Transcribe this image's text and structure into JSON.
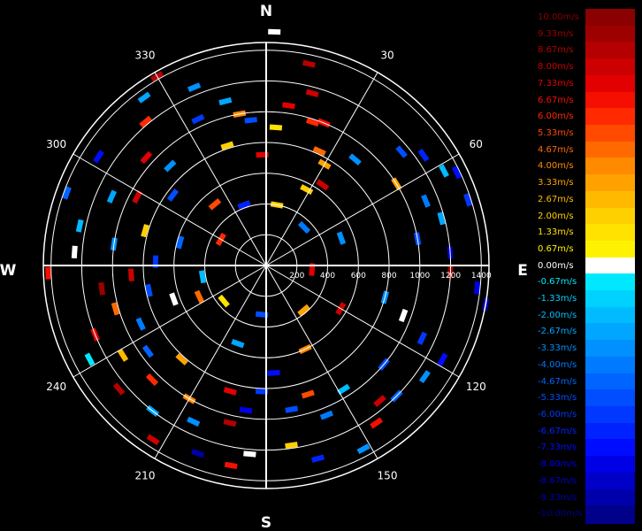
{
  "chart_data": {
    "type": "polar-radar",
    "compass": {
      "north": "N",
      "east": "E",
      "south": "S",
      "west": "W"
    },
    "azimuth_labels": [
      "30",
      "60",
      "120",
      "150",
      "210",
      "240",
      "300",
      "330"
    ],
    "azimuths_deg": [
      30,
      60,
      120,
      150,
      210,
      240,
      300,
      330
    ],
    "range_labels": [
      "200",
      "400",
      "600",
      "800",
      "1000",
      "1200",
      "1400"
    ],
    "range_values": [
      200,
      400,
      600,
      800,
      1000,
      1200,
      1400
    ],
    "range_max": 1450,
    "grid": true,
    "legend_placement": "right",
    "legend": [
      {
        "label": "10.00m/s",
        "color": "#8b0000"
      },
      {
        "label": "9.33m/s",
        "color": "#9e0000"
      },
      {
        "label": "8.67m/s",
        "color": "#b40000"
      },
      {
        "label": "8.00m/s",
        "color": "#cc0000"
      },
      {
        "label": "7.33m/s",
        "color": "#e30000"
      },
      {
        "label": "6.67m/s",
        "color": "#f50f00"
      },
      {
        "label": "6.00m/s",
        "color": "#ff2a00"
      },
      {
        "label": "5.33m/s",
        "color": "#ff4a00"
      },
      {
        "label": "4.67m/s",
        "color": "#ff6a00"
      },
      {
        "label": "4.00m/s",
        "color": "#ff8a00"
      },
      {
        "label": "3.33m/s",
        "color": "#ffa200"
      },
      {
        "label": "2.67m/s",
        "color": "#ffba00"
      },
      {
        "label": "2.00m/s",
        "color": "#ffd000"
      },
      {
        "label": "1.33m/s",
        "color": "#ffe200"
      },
      {
        "label": "0.67m/s",
        "color": "#fff200"
      },
      {
        "label": "0.00m/s",
        "color": "#ffffff"
      },
      {
        "label": "-0.67m/s",
        "color": "#00e8ff"
      },
      {
        "label": "-1.33m/s",
        "color": "#00d2ff"
      },
      {
        "label": "-2.00m/s",
        "color": "#00bcff"
      },
      {
        "label": "-2.67m/s",
        "color": "#00a6ff"
      },
      {
        "label": "-3.33m/s",
        "color": "#0090ff"
      },
      {
        "label": "-4.00m/s",
        "color": "#007aff"
      },
      {
        "label": "-4.67m/s",
        "color": "#0064ff"
      },
      {
        "label": "-5.33m/s",
        "color": "#004eff"
      },
      {
        "label": "-6.00m/s",
        "color": "#0038ff"
      },
      {
        "label": "-6.67m/s",
        "color": "#0022ff"
      },
      {
        "label": "-7.33m/s",
        "color": "#000cff"
      },
      {
        "label": "-8.00m/s",
        "color": "#0000e6"
      },
      {
        "label": "-8.67m/s",
        "color": "#0000c8"
      },
      {
        "label": "-9.33m/s",
        "color": "#0000aa"
      },
      {
        "label": "-10.00m/s",
        "color": "#00008b"
      }
    ],
    "gates": [
      {
        "az": 2,
        "r": 1520,
        "v": 0.0
      },
      {
        "az": 12,
        "r": 1340,
        "v": 8.7
      },
      {
        "az": 15,
        "r": 1160,
        "v": 8.0
      },
      {
        "az": 8,
        "r": 1050,
        "v": 7.3
      },
      {
        "az": 18,
        "r": 980,
        "v": 6.0
      },
      {
        "az": 4,
        "r": 900,
        "v": 1.3
      },
      {
        "az": 25,
        "r": 820,
        "v": 4.7
      },
      {
        "az": 22,
        "r": 1000,
        "v": 6.7
      },
      {
        "az": 30,
        "r": 760,
        "v": 3.3
      },
      {
        "az": 28,
        "r": 560,
        "v": 2.0
      },
      {
        "az": 35,
        "r": 640,
        "v": 8.0
      },
      {
        "az": 40,
        "r": 900,
        "v": -3.3
      },
      {
        "az": 50,
        "r": 1150,
        "v": -5.3
      },
      {
        "az": 55,
        "r": 1250,
        "v": -6.7
      },
      {
        "az": 62,
        "r": 1310,
        "v": -2.0
      },
      {
        "az": 64,
        "r": 1380,
        "v": -7.3
      },
      {
        "az": 58,
        "r": 1000,
        "v": 3.3
      },
      {
        "az": 68,
        "r": 1120,
        "v": -4.0
      },
      {
        "az": 72,
        "r": 1380,
        "v": -6.0
      },
      {
        "az": 75,
        "r": 1180,
        "v": -2.7
      },
      {
        "az": 80,
        "r": 1000,
        "v": -5.3
      },
      {
        "az": 86,
        "r": 1200,
        "v": -8.7
      },
      {
        "az": 92,
        "r": 1200,
        "v": 9.3
      },
      {
        "az": 96,
        "r": 1380,
        "v": -8.0
      },
      {
        "az": 100,
        "r": 1450,
        "v": -9.3
      },
      {
        "az": 105,
        "r": 800,
        "v": -3.3
      },
      {
        "az": 110,
        "r": 950,
        "v": 0.0
      },
      {
        "az": 115,
        "r": 1120,
        "v": -6.0
      },
      {
        "az": 118,
        "r": 1300,
        "v": -7.3
      },
      {
        "az": 125,
        "r": 1260,
        "v": -3.3
      },
      {
        "az": 130,
        "r": 1000,
        "v": -5.3
      },
      {
        "az": 135,
        "r": 1200,
        "v": -4.7
      },
      {
        "az": 140,
        "r": 1150,
        "v": 8.0
      },
      {
        "az": 145,
        "r": 1250,
        "v": 6.7
      },
      {
        "az": 148,
        "r": 950,
        "v": -2.0
      },
      {
        "az": 152,
        "r": 1350,
        "v": -3.3
      },
      {
        "az": 155,
        "r": 600,
        "v": 4.0
      },
      {
        "az": 158,
        "r": 1050,
        "v": -4.0
      },
      {
        "az": 162,
        "r": 880,
        "v": 5.3
      },
      {
        "az": 165,
        "r": 1300,
        "v": -6.7
      },
      {
        "az": 170,
        "r": 950,
        "v": -5.3
      },
      {
        "az": 172,
        "r": 1180,
        "v": 2.0
      },
      {
        "az": 176,
        "r": 700,
        "v": -7.3
      },
      {
        "az": 182,
        "r": 820,
        "v": -6.0
      },
      {
        "az": 185,
        "r": 1230,
        "v": 0.0
      },
      {
        "az": 188,
        "r": 950,
        "v": -8.0
      },
      {
        "az": 190,
        "r": 1320,
        "v": 6.7
      },
      {
        "az": 193,
        "r": 1050,
        "v": 8.7
      },
      {
        "az": 196,
        "r": 850,
        "v": 7.3
      },
      {
        "az": 200,
        "r": 1300,
        "v": -9.3
      },
      {
        "az": 205,
        "r": 1120,
        "v": -3.3
      },
      {
        "az": 210,
        "r": 1000,
        "v": 4.0
      },
      {
        "az": 213,
        "r": 1350,
        "v": 8.0
      },
      {
        "az": 218,
        "r": 1200,
        "v": -2.7
      },
      {
        "az": 222,
        "r": 820,
        "v": 3.3
      },
      {
        "az": 225,
        "r": 1050,
        "v": 6.0
      },
      {
        "az": 230,
        "r": 1250,
        "v": 8.7
      },
      {
        "az": 234,
        "r": 950,
        "v": -4.7
      },
      {
        "az": 238,
        "r": 1100,
        "v": 2.7
      },
      {
        "az": 242,
        "r": 1300,
        "v": -0.7
      },
      {
        "az": 245,
        "r": 900,
        "v": -4.0
      },
      {
        "az": 248,
        "r": 1200,
        "v": 7.3
      },
      {
        "az": 250,
        "r": 640,
        "v": 0.0
      },
      {
        "az": 254,
        "r": 1020,
        "v": 4.7
      },
      {
        "az": 258,
        "r": 780,
        "v": -5.3
      },
      {
        "az": 262,
        "r": 1080,
        "v": 9.3
      },
      {
        "az": 266,
        "r": 880,
        "v": 8.0
      },
      {
        "az": 268,
        "r": 1420,
        "v": 6.7
      },
      {
        "az": 272,
        "r": 720,
        "v": -6.0
      },
      {
        "az": 274,
        "r": 1250,
        "v": 0.0
      },
      {
        "az": 278,
        "r": 1000,
        "v": -3.3
      },
      {
        "az": 282,
        "r": 1240,
        "v": -2.0
      },
      {
        "az": 286,
        "r": 820,
        "v": 2.0
      },
      {
        "az": 290,
        "r": 1380,
        "v": -4.7
      },
      {
        "az": 294,
        "r": 1100,
        "v": -2.7
      },
      {
        "az": 298,
        "r": 950,
        "v": 8.0
      },
      {
        "az": 303,
        "r": 1300,
        "v": -7.3
      },
      {
        "az": 307,
        "r": 760,
        "v": -5.3
      },
      {
        "az": 312,
        "r": 1050,
        "v": 7.3
      },
      {
        "az": 316,
        "r": 900,
        "v": -3.3
      },
      {
        "az": 320,
        "r": 1220,
        "v": 6.0
      },
      {
        "az": 324,
        "r": 1350,
        "v": -2.7
      },
      {
        "az": 330,
        "r": 1420,
        "v": 8.7
      },
      {
        "az": 335,
        "r": 1050,
        "v": -6.0
      },
      {
        "az": 338,
        "r": 1250,
        "v": -3.3
      },
      {
        "az": 342,
        "r": 820,
        "v": 2.0
      },
      {
        "az": 346,
        "r": 1100,
        "v": -2.7
      },
      {
        "az": 350,
        "r": 1000,
        "v": 4.0
      },
      {
        "az": 354,
        "r": 950,
        "v": -5.3
      },
      {
        "az": 358,
        "r": 720,
        "v": 7.3
      },
      {
        "az": 10,
        "r": 400,
        "v": 2.0
      },
      {
        "az": 45,
        "r": 350,
        "v": -4.0
      },
      {
        "az": 95,
        "r": 300,
        "v": 7.3
      },
      {
        "az": 140,
        "r": 380,
        "v": 3.3
      },
      {
        "az": 185,
        "r": 320,
        "v": -5.3
      },
      {
        "az": 230,
        "r": 360,
        "v": 1.3
      },
      {
        "az": 260,
        "r": 420,
        "v": -2.0
      },
      {
        "az": 300,
        "r": 340,
        "v": 6.0
      },
      {
        "az": 340,
        "r": 420,
        "v": -6.7
      },
      {
        "az": 70,
        "r": 520,
        "v": -3.3
      },
      {
        "az": 120,
        "r": 560,
        "v": 8.0
      },
      {
        "az": 200,
        "r": 540,
        "v": -2.7
      },
      {
        "az": 245,
        "r": 480,
        "v": 4.7
      },
      {
        "az": 285,
        "r": 580,
        "v": -4.7
      },
      {
        "az": 320,
        "r": 520,
        "v": 5.3
      }
    ]
  }
}
